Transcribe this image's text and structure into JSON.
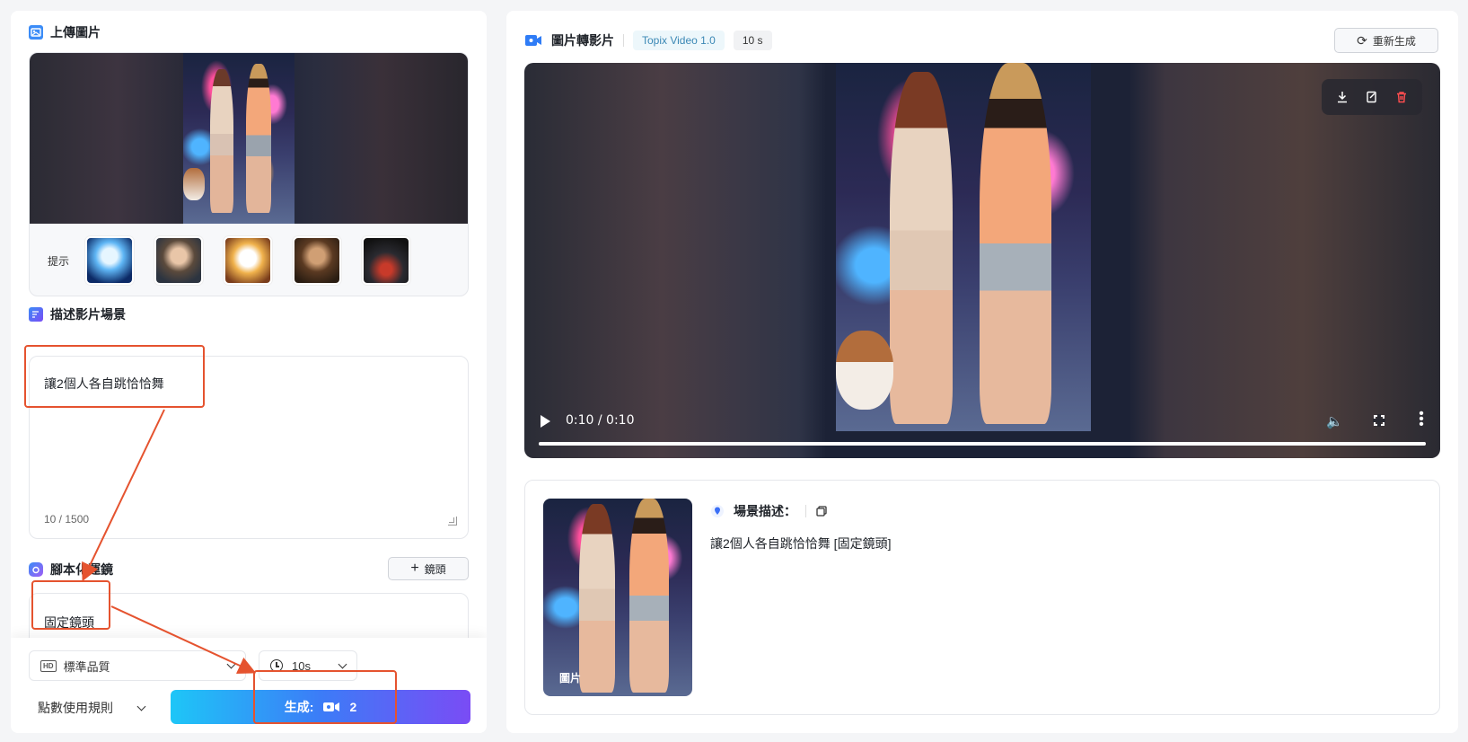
{
  "left": {
    "upload_title": "上傳圖片",
    "hint_label": "提示",
    "hint_thumbs": [
      "ice-portrait",
      "warrior-portrait",
      "cat-figure",
      "man-portrait",
      "car-night"
    ],
    "describe_title": "描述影片場景",
    "describe_text": "讓2個人各自跳恰恰舞",
    "describe_count": "10 / 1500",
    "shot_title": "腳本化運鏡",
    "add_shot_label": "鏡頭",
    "shot_value": "固定鏡頭",
    "quality_value": "標準品質",
    "duration_value": "10s",
    "points_rule_label": "點數使用規則",
    "generate_label": "生成:",
    "generate_cost": "2"
  },
  "right": {
    "title": "圖片轉影片",
    "model_badge": "Topix Video 1.0",
    "duration_badge": "10 s",
    "regenerate_label": "重新生成",
    "video_time": "0:10 / 0:10",
    "video_progress": 1.0,
    "scene_label": "場景描述：",
    "scene_text": "讓2個人各自跳恰恰舞 [固定鏡頭]",
    "thumb_tag": "圖片"
  },
  "colors": {
    "accent_gradient_start": "#1ec6f7",
    "accent_gradient_end": "#7a4cf5",
    "annotation_red": "#e5532f",
    "delete_red": "#ff4d4f"
  }
}
